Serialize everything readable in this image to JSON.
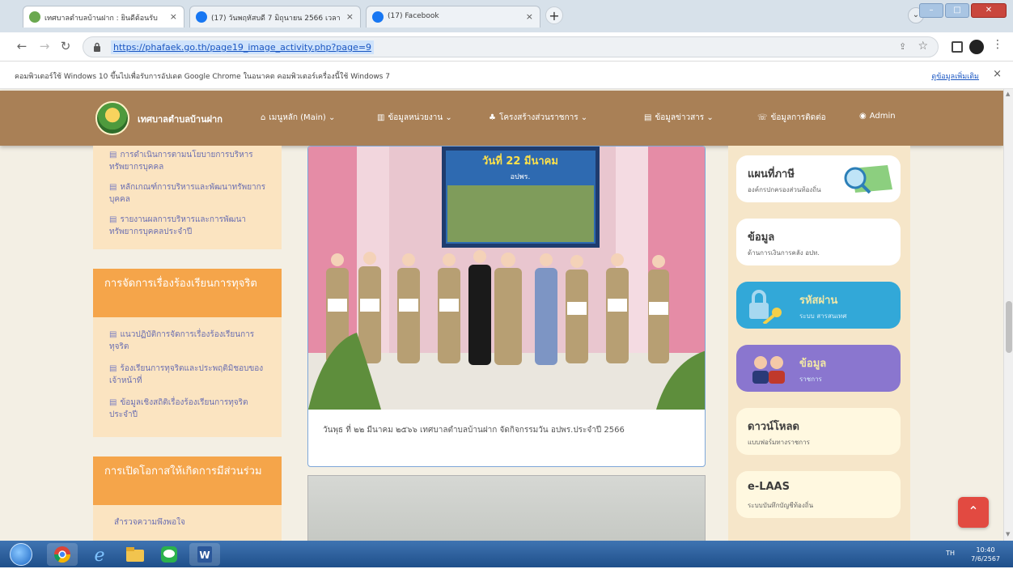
{
  "browser": {
    "tabs": [
      {
        "title": "เทศบาลตำบลบ้านฝาก : ยินดีต้อนรับ",
        "active": true,
        "icon_color": "#6aa84f"
      },
      {
        "title": "(17) วันพฤหัสบดี 7 มิถุนายน 2566 เวลา",
        "active": false,
        "icon_color": "#1877f2"
      },
      {
        "title": "(17) Facebook",
        "active": false,
        "icon_color": "#1877f2"
      }
    ],
    "close_glyph": "×",
    "new_tab_glyph": "+",
    "window_buttons": {
      "minimize": "–",
      "maximize": "□",
      "close": "✕"
    },
    "url": "https://phafaek.go.th/page19_image_activity.php?page=9",
    "info_message": "คอมพิวเตอร์ใช้ Windows 10 ขึ้นไปเพื่อรับการอัปเดต Google Chrome ในอนาคต คอมพิวเตอร์เครื่องนี้ใช้ Windows 7",
    "info_link": "ดูข้อมูลเพิ่มเติม",
    "info_close": "×"
  },
  "site": {
    "name": "เทศบาลตำบลบ้านฝาก",
    "nav": [
      {
        "icon": "home-icon",
        "glyph": "⌂",
        "label": "เมนูหลัก (Main) ⌄"
      },
      {
        "icon": "bank-icon",
        "glyph": "▥",
        "label": "ข้อมูลหน่วยงาน ⌄"
      },
      {
        "icon": "org-chart-icon",
        "glyph": "♣",
        "label": "โครงสร้างส่วนราชการ ⌄"
      },
      {
        "icon": "news-icon",
        "glyph": "▤",
        "label": "ข้อมูลข่าวสาร ⌄"
      },
      {
        "icon": "phone-icon",
        "glyph": "☏",
        "label": "ข้อมูลการติดต่อ"
      },
      {
        "icon": "user-icon",
        "glyph": "◉",
        "label": "Admin"
      }
    ]
  },
  "left_sidebar": {
    "top_items": [
      "การดำเนินการตามนโยบายการบริหารทรัพยากรบุคคล",
      "หลักเกณฑ์การบริหารและพัฒนาทรัพยากรบุคคล",
      "รายงานผลการบริหารและการพัฒนาทรัพยากรบุคคลประจำปี"
    ],
    "section2_title": "การจัดการเรื่องร้องเรียนการทุจริต",
    "section2_items": [
      "แนวปฏิบัติการจัดการเรื่องร้องเรียนการทุจริต",
      "ร้องเรียนการทุจริตและประพฤติมิชอบของเจ้าหน้าที่",
      "ข้อมูลเชิงสถิติเรื่องร้องเรียนการทุจริตประจำปี"
    ],
    "section3_title": "การเปิดโอกาสให้เกิดการมีส่วนร่วม",
    "section3_items": [
      "สำรวจความพึงพอใจ"
    ]
  },
  "activity": {
    "banner_line1": "วันที่ 22 มีนาคม",
    "banner_line2": "อปพร.",
    "caption": "วันพุธ ที่ ๒๒ มีนาคม ๒๕๖๖ เทศบาลตำบลบ้านฝาก จัดกิจกรรมวัน อปพร.ประจำปี 2566"
  },
  "right_sidebar": {
    "cards": [
      {
        "title": "แผนที่ภาษี",
        "subtitle": "องค์กรปกครองส่วนท้องถิ่น",
        "style": "white"
      },
      {
        "title": "ข้อมูล",
        "subtitle": "ด้านการเงินการคลัง อปท.",
        "style": "white"
      },
      {
        "title": "รหัสผ่าน",
        "subtitle": "ระบบ สารสนเทศ",
        "style": "blue"
      },
      {
        "title": "ข้อมูล",
        "subtitle": "ราชการ",
        "style": "purple"
      },
      {
        "title": "ดาวน์โหลด",
        "subtitle": "แบบฟอร์มทางราชการ",
        "style": "yellow"
      },
      {
        "title": "e-LAAS",
        "subtitle": "ระบบบันทึกบัญชีท้องถิ่น",
        "style": "yellow"
      }
    ]
  },
  "back_to_top": "⌃",
  "taskbar": {
    "tray_text": "TH",
    "time": "10:40",
    "date": "7/6/2567"
  }
}
